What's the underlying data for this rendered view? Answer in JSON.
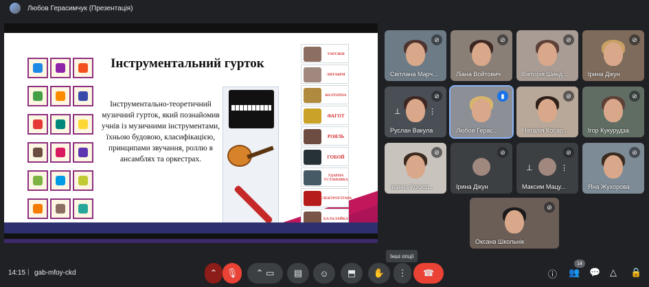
{
  "topbar": {
    "title": "Любов Герасимчук (Презентація)"
  },
  "slide": {
    "title": "Інструментальний гурток",
    "description": "Інструментально-теоретичний музичний гурток, який познайомив учнів із музичними інструментами, їхньою будовою, класифікацією, принципами звучання, роллю в ансамблях та оркестрах.",
    "cards": [
      {
        "label": "ТАРІЛКИ",
        "color": "#8d6e63"
      },
      {
        "label": "ЛИТАВРИ",
        "color": "#a1887f"
      },
      {
        "label": "ВАЛТОРНА",
        "color": "#b08a3e"
      },
      {
        "label": "ФАГОТ",
        "color": "#c9a227"
      },
      {
        "label": "РОЯЛЬ",
        "color": "#6d4c41"
      },
      {
        "label": "ГОБОЙ",
        "color": "#263238"
      },
      {
        "label": "УДАРНА УСТАНОВКА",
        "color": "#455a64"
      },
      {
        "label": "ЕЛЕКТРОГІТАРА",
        "color": "#b71c1c"
      },
      {
        "label": "БАЛАЛАЙКА",
        "color": "#795548"
      }
    ],
    "icon_colors": [
      "#1e88e5",
      "#8e24aa",
      "#f4511e",
      "#43a047",
      "#fb8c00",
      "#3949ab",
      "#e53935",
      "#00897b",
      "#fdd835",
      "#6d4c41",
      "#d81b60",
      "#5e35b1",
      "#7cb342",
      "#039be5",
      "#c0ca33",
      "#f57c00",
      "#8d6e63",
      "#26a69a"
    ]
  },
  "participants": [
    {
      "name": "Світлана Марч...",
      "muted": true
    },
    {
      "name": "Ліана Войтович",
      "muted": true
    },
    {
      "name": "Вікторія Шинд...",
      "muted": true
    },
    {
      "name": "Ірина Дікун",
      "muted": true
    },
    {
      "name": "Руслан Вакула",
      "muted": true
    },
    {
      "name": "Любов Герас...",
      "muted": false,
      "speaking": true
    },
    {
      "name": "Наталія Косар...",
      "muted": true
    },
    {
      "name": "Ігор Кукурудза",
      "muted": true
    },
    {
      "name": "Іванна Коцюд...",
      "muted": true
    },
    {
      "name": "Ірина Дікун",
      "muted": true
    },
    {
      "name": "Максим Мацу...",
      "muted": true
    },
    {
      "name": "Яна Жухорова",
      "muted": true
    },
    {
      "name": "Оксана Школьнік",
      "muted": true
    }
  ],
  "bottombar": {
    "time": "14:15",
    "separator": "|",
    "meeting_code": "gab-mfoy-ckd",
    "tooltip": "Інші опції",
    "participants_count": "14"
  }
}
